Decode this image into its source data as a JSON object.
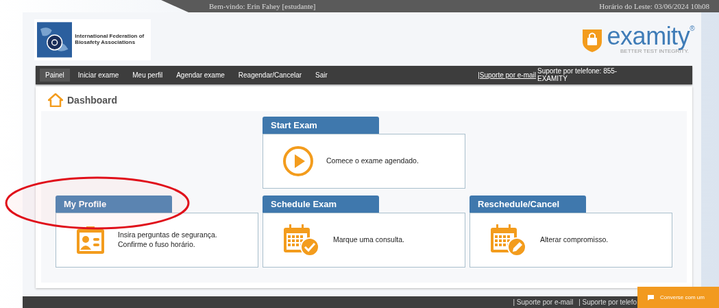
{
  "top_bar": {
    "welcome": "Bem-vindo:  Erin Fahey [estudante]",
    "time": "Horário do Leste: 03/06/2024 10h08"
  },
  "org_logo": {
    "text": "International Federation of Biosafety Associations"
  },
  "brand": {
    "name": "examity$^{®}$",
    "tagline": "BETTER TEST INTEGRITY."
  },
  "nav": {
    "items": [
      {
        "label": "Painel",
        "selected": true
      },
      {
        "label": "Iniciar exame",
        "selected": false
      },
      {
        "label": "Meu perfil",
        "selected": false
      },
      {
        "label": "Agendar exame",
        "selected": false
      },
      {
        "label": "Reagendar/Cancelar",
        "selected": false
      },
      {
        "label": "Sair",
        "selected": false
      }
    ],
    "email_link": "|Suporte por e-mail",
    "phone": "Suporte por telefone: 855-EXAMITY"
  },
  "page_title": "Dashboard",
  "rows": [
    {
      "cards": [
        {
          "title": "Start Exam",
          "kind": "play",
          "lines": [
            "Comece o exame agendado."
          ]
        }
      ]
    },
    {
      "cards": [
        {
          "title": "My Profile",
          "kind": "profile",
          "lines": [
            "Insira perguntas de segurança.",
            "Confirme o fuso horário."
          ]
        },
        {
          "title": "Schedule Exam",
          "kind": "calendar-check",
          "lines": [
            "Marque uma consulta."
          ]
        },
        {
          "title": "Reschedule/Cancel",
          "kind": "calendar-edit",
          "lines": [
            "Alterar compromisso."
          ]
        }
      ]
    }
  ],
  "footer": {
    "links": [
      "| Suporte por e-mail",
      "| Suporte por telefo"
    ]
  },
  "chat_button": "Converse com um"
}
